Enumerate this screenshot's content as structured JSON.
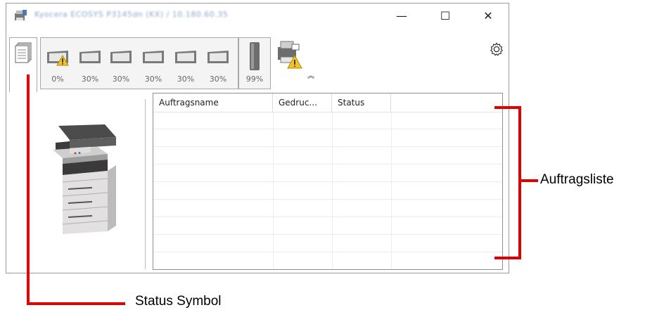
{
  "window": {
    "title": "Kyocera ECOSYS P3145dn (KX) / 10.180.60.35",
    "minimize_label": "—",
    "maximize_label": "☐",
    "close_label": "✕"
  },
  "toolbar": {
    "paper_levels": [
      "0%",
      "30%",
      "30%",
      "30%",
      "30%",
      "30%"
    ],
    "toner_level": "99%",
    "collapse_label": "︽"
  },
  "job_list": {
    "columns": [
      "Auftragsname",
      "Gedruc...",
      "Status",
      ""
    ],
    "rows": [
      [
        "",
        "",
        "",
        ""
      ],
      [
        "",
        "",
        "",
        ""
      ],
      [
        "",
        "",
        "",
        ""
      ],
      [
        "",
        "",
        "",
        ""
      ],
      [
        "",
        "",
        "",
        ""
      ],
      [
        "",
        "",
        "",
        ""
      ],
      [
        "",
        "",
        "",
        ""
      ],
      [
        "",
        "",
        "",
        ""
      ],
      [
        "",
        "",
        "",
        ""
      ]
    ]
  },
  "annotations": {
    "job_list_label": "Auftragsliste",
    "status_icon_label": "Status Symbol"
  },
  "colors": {
    "annotation_red": "#e00000",
    "warning_yellow": "#f2c12e"
  }
}
